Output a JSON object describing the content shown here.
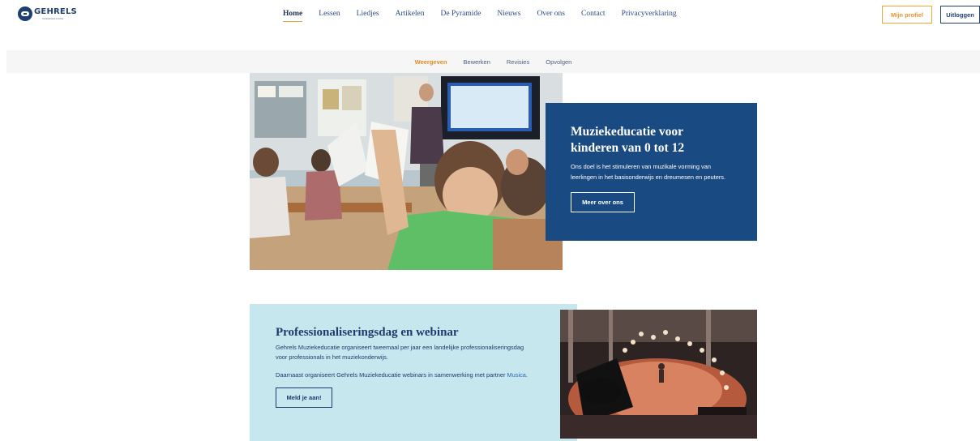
{
  "header": {
    "logo": {
      "word": "GEHRELS",
      "sub": "MUZIEKEDUCATIE"
    },
    "nav": [
      {
        "label": "Home",
        "active": true
      },
      {
        "label": "Lessen",
        "active": false
      },
      {
        "label": "Liedjes",
        "active": false
      },
      {
        "label": "Artikelen",
        "active": false
      },
      {
        "label": "De Pyramide",
        "active": false
      },
      {
        "label": "Nieuws",
        "active": false
      },
      {
        "label": "Over ons",
        "active": false
      },
      {
        "label": "Contact",
        "active": false
      },
      {
        "label": "Privacyverklaring",
        "active": false
      }
    ],
    "profile_label": "Mijn profiel",
    "logout_label": "Uitloggen"
  },
  "subtabs": [
    {
      "label": "Weergeven",
      "active": true
    },
    {
      "label": "Bewerken",
      "active": false
    },
    {
      "label": "Revisies",
      "active": false
    },
    {
      "label": "Opvolgen",
      "active": false
    }
  ],
  "hero": {
    "title": "Muziekeducatie voor kinderen van 0 tot 12",
    "text": "Ons doel is het stimuleren van muzikale vorming van leerlingen in het basisonderwijs en dreumesen en peuters.",
    "button": "Meer over ons"
  },
  "promo": {
    "title": "Professionaliseringsdag en webinar",
    "text1": "Gehrels Muziekeducatie organiseert tweemaal per jaar een landelijke professionaliseringsdag voor professionals in het muziekonderwijs.",
    "text2_prefix": "Daarnaast organiseert Gehrels Muziekeducatie webinars in samenwerking met partner ",
    "text2_link": "Musica",
    "text2_suffix": ".",
    "button": "Meld je aan!"
  },
  "colors": {
    "accent": "#e38a1e",
    "navy": "#1a4a82",
    "light_blue": "#c7e7ef"
  },
  "icons": [
    "gehrels-logo-icon"
  ]
}
